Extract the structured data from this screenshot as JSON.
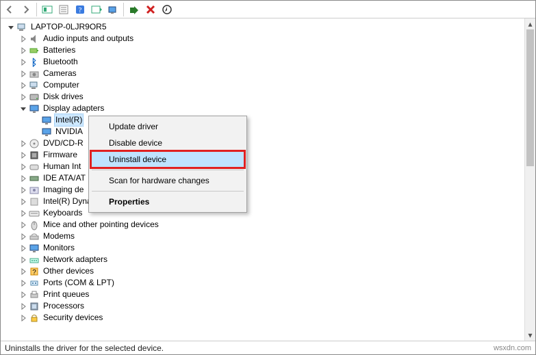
{
  "toolbar": {
    "back": "←",
    "forward": "→"
  },
  "root": {
    "label": "LAPTOP-0LJR9OR5"
  },
  "categories": [
    {
      "label": "Audio inputs and outputs",
      "icon": "audio"
    },
    {
      "label": "Batteries",
      "icon": "battery"
    },
    {
      "label": "Bluetooth",
      "icon": "bt"
    },
    {
      "label": "Cameras",
      "icon": "camera"
    },
    {
      "label": "Computer",
      "icon": "pc"
    },
    {
      "label": "Disk drives",
      "icon": "disk"
    },
    {
      "label": "Display adapters",
      "icon": "monitor",
      "expanded": true,
      "children": [
        {
          "label": "Intel(R)",
          "icon": "monitor",
          "selected": true
        },
        {
          "label": "NVIDIA",
          "icon": "monitor"
        }
      ]
    },
    {
      "label": "DVD/CD-R",
      "icon": "optical",
      "truncated": true
    },
    {
      "label": "Firmware",
      "icon": "chip"
    },
    {
      "label": "Human Int",
      "icon": "hid",
      "truncated": true
    },
    {
      "label": "IDE ATA/AT",
      "icon": "ide",
      "truncated": true
    },
    {
      "label": "Imaging de",
      "icon": "imaging",
      "truncated": true
    },
    {
      "label": "Intel(R) Dynamic Platform and Thermal Framework",
      "icon": "generic"
    },
    {
      "label": "Keyboards",
      "icon": "kbd"
    },
    {
      "label": "Mice and other pointing devices",
      "icon": "mouse"
    },
    {
      "label": "Modems",
      "icon": "modem"
    },
    {
      "label": "Monitors",
      "icon": "monitor"
    },
    {
      "label": "Network adapters",
      "icon": "net"
    },
    {
      "label": "Other devices",
      "icon": "other"
    },
    {
      "label": "Ports (COM & LPT)",
      "icon": "port"
    },
    {
      "label": "Print queues",
      "icon": "printer"
    },
    {
      "label": "Processors",
      "icon": "cpu"
    },
    {
      "label": "Security devices",
      "icon": "security"
    }
  ],
  "contextMenu": {
    "items": [
      {
        "label": "Update driver"
      },
      {
        "label": "Disable device"
      },
      {
        "label": "Uninstall device",
        "highlight": true
      },
      {
        "divider": true
      },
      {
        "label": "Scan for hardware changes"
      },
      {
        "divider": true
      },
      {
        "label": "Properties",
        "bold": true
      }
    ]
  },
  "status": {
    "text": "Uninstalls the driver for the selected device."
  },
  "watermark": "wsxdn.com"
}
